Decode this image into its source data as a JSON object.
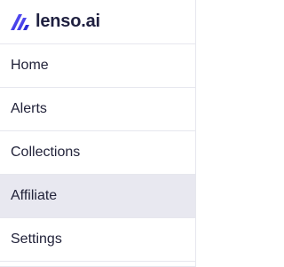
{
  "brand": {
    "name": "lenso.ai",
    "accent_start": "#6a5cff",
    "accent_end": "#2b2bd6"
  },
  "menu": {
    "items": [
      {
        "label": "Home"
      },
      {
        "label": "Alerts"
      },
      {
        "label": "Collections"
      },
      {
        "label": "Affiliate",
        "active": true
      },
      {
        "label": "Settings"
      }
    ]
  }
}
